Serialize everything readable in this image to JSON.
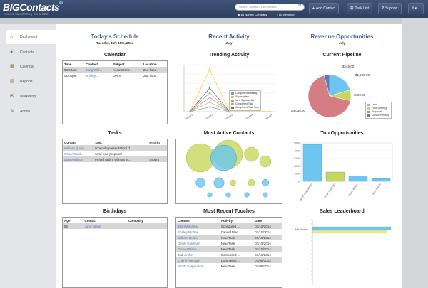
{
  "header": {
    "logo": "BIGContacts",
    "logo_reg": "®",
    "tagline": "WORK SMARTER | DO MORE",
    "search_placeholder": "Search Contact / Last Viewed",
    "radio_name_company": "By Name / Company",
    "radio_keyword": "By Keyword",
    "add_contact": "Add Contact",
    "task_list": "Task List",
    "support": "Support"
  },
  "nav": [
    {
      "label": "Dashboard",
      "icon": "home-icon",
      "glyph": "⌂"
    },
    {
      "label": "Contacts",
      "icon": "person-icon",
      "glyph": "●"
    },
    {
      "label": "Calendar",
      "icon": "calendar-icon",
      "glyph": "▦"
    },
    {
      "label": "Reports",
      "icon": "reports-icon",
      "glyph": "▤"
    },
    {
      "label": "Marketing",
      "icon": "marketing-icon",
      "glyph": "✉"
    },
    {
      "label": "Admin",
      "icon": "admin-icon",
      "glyph": "✎"
    }
  ],
  "columns": {
    "schedule": {
      "title": "Today's Schedule",
      "sub": "Tuesday, July 15th, 2014"
    },
    "activity": {
      "title": "Recent Activity",
      "sub": "July"
    },
    "revenue": {
      "title": "Revenue Opportunities",
      "sub": "July"
    }
  },
  "calendar": {
    "title": "Calendar",
    "headers": [
      "Time",
      "Contact",
      "Subject",
      "Location"
    ],
    "rows": [
      [
        "08:00am",
        "Jung Willi...",
        "Accountant...",
        "2nd floor..."
      ],
      [
        "01:00pm",
        "Shirley ...",
        "Demo",
        "2nd floor..."
      ]
    ]
  },
  "tasks": {
    "title": "Tasks",
    "headers": [
      "Contact",
      "Task",
      "Priority"
    ],
    "rows": [
      [
        "William Quinn",
        "schedule presentation/ d...",
        ""
      ],
      [
        "Oscar Gold...",
        "send new proposal",
        ""
      ],
      [
        "Diane Wilson",
        "Predef task 0 without st...",
        "Urgent"
      ]
    ]
  },
  "birthdays": {
    "title": "Birthdays",
    "headers": [
      "Age",
      "Contact",
      "Company"
    ],
    "rows": [
      [
        "55",
        "John Glenn",
        ""
      ]
    ]
  },
  "touches": {
    "title": "Most Recent Touches",
    "headers": [
      "Contact",
      "Activity",
      "Date"
    ],
    "rows": [
      [
        "Jung Williams",
        "Scheduled ...",
        "07/15/2014"
      ],
      [
        "Shirley McRae",
        "Cancel Mee...",
        "07/15/2014"
      ],
      [
        "William Quinn",
        "New Task",
        "07/15/2014"
      ],
      [
        "Oscar Goldman",
        "New Task",
        "07/15/2014"
      ],
      [
        "Diane Wilson",
        "New Task",
        "07/15/2014"
      ],
      [
        "Judi Archer",
        "Completed ...",
        "07/15/2014"
      ],
      [
        "Cheryl Ramsay",
        "Completed ...",
        "07/08/2014"
      ],
      [
        "BASF Corporation",
        "New Task",
        "07/08/2014"
      ]
    ]
  },
  "trending": {
    "title": "Trending Activity",
    "chart_data": {
      "type": "line",
      "x": [
        "Week1",
        "Week2",
        "Week3",
        "Week4",
        "Week5"
      ],
      "series": [
        {
          "name": "Completed Meeting",
          "color": "#6aa6e0",
          "values": [
            0,
            1,
            0,
            0,
            0
          ]
        },
        {
          "name": "Skype video",
          "color": "#c8d64a",
          "values": [
            0,
            2,
            0,
            0,
            0
          ]
        },
        {
          "name": "New Opportunity",
          "color": "#d987c4",
          "values": [
            0,
            3,
            0,
            0,
            0
          ]
        },
        {
          "name": "Completed Task",
          "color": "#98c85a",
          "values": [
            0,
            4,
            0,
            0,
            0
          ]
        },
        {
          "name": "Completed Task Step",
          "color": "#7a5fbf",
          "values": [
            0,
            5,
            0,
            0,
            0
          ]
        },
        {
          "name": "",
          "color": "#f1d433",
          "values": [
            0,
            9,
            0,
            0,
            0
          ]
        }
      ],
      "ylim": [
        0,
        10
      ]
    }
  },
  "pipeline": {
    "title": "Current Pipeline",
    "chart_data": {
      "type": "pie",
      "labels": [
        "Lead",
        "Final Meeting",
        "Proposal",
        "Closed/Pending"
      ],
      "values": [
        1225,
        490,
        4035,
        245
      ],
      "value_labels": [
        "$1,225.00",
        "$490.00",
        "$4,035.00",
        "$245.00"
      ],
      "colors": [
        "#6cc6ef",
        "#c6d85c",
        "#d67d84",
        "#4f7fc4"
      ]
    }
  },
  "active": {
    "title": "Most Active Contacts",
    "chart_data": {
      "type": "scatter",
      "bubbles": [
        {
          "x": 2,
          "y": 6,
          "r": 5,
          "c": "#c6d85c"
        },
        {
          "x": 5,
          "y": 6.5,
          "r": 5,
          "c": "#c6d85c"
        },
        {
          "x": 4.5,
          "y": 6,
          "r": 4.5,
          "c": "#6cc6ef"
        },
        {
          "x": 7.5,
          "y": 6.5,
          "r": 2.5,
          "c": "#c6d85c"
        },
        {
          "x": 9,
          "y": 5.5,
          "r": 2,
          "c": "#c6d85c"
        },
        {
          "x": 2,
          "y": 2.5,
          "r": 1.6,
          "c": "#6cc6ef"
        },
        {
          "x": 4,
          "y": 2.5,
          "r": 1.8,
          "c": "#6cc6ef"
        },
        {
          "x": 5.5,
          "y": 2.5,
          "r": 1,
          "c": "#c6d85c"
        },
        {
          "x": 7.5,
          "y": 2.5,
          "r": 1.2,
          "c": "#c6d85c"
        },
        {
          "x": 9,
          "y": 2.5,
          "r": 1.2,
          "c": "#6cc6ef"
        },
        {
          "x": 3,
          "y": 0.8,
          "r": 0.8,
          "c": "#6cc6ef"
        },
        {
          "x": 5,
          "y": 0.8,
          "r": 0.8,
          "c": "#6cc6ef"
        },
        {
          "x": 7,
          "y": 0.8,
          "r": 0.8,
          "c": "#6cc6ef"
        },
        {
          "x": 9,
          "y": 0.8,
          "r": 0.8,
          "c": "#6cc6ef"
        }
      ]
    }
  },
  "top": {
    "title": "Top Opportunities",
    "chart_data": {
      "type": "bar",
      "categories": [
        "BASF Corporation",
        "Oscar Goldman",
        "Diane Wilson",
        "Arch Intexts"
      ],
      "values": [
        4800,
        1200,
        700,
        350
      ],
      "colors": [
        "#6cc6ef",
        "#c6d85c",
        "#6cc6ef",
        "#6cc6ef"
      ],
      "ylim": [
        0,
        5000
      ],
      "yticks": [
        "0",
        "1000",
        "2000",
        "3000",
        "4000",
        "5000"
      ]
    }
  },
  "leaderboard": {
    "title": "Sales Leaderboard",
    "chart_data": {
      "type": "bar",
      "orientation": "horizontal",
      "categories": [
        "Bob Hansen"
      ],
      "category_labels": [
        "Bob Hanson..."
      ],
      "series": [
        {
          "color": "#6cc6ef",
          "values": [
            100
          ]
        },
        {
          "color": "#e8ec7a",
          "values": [
            95
          ]
        }
      ]
    }
  }
}
